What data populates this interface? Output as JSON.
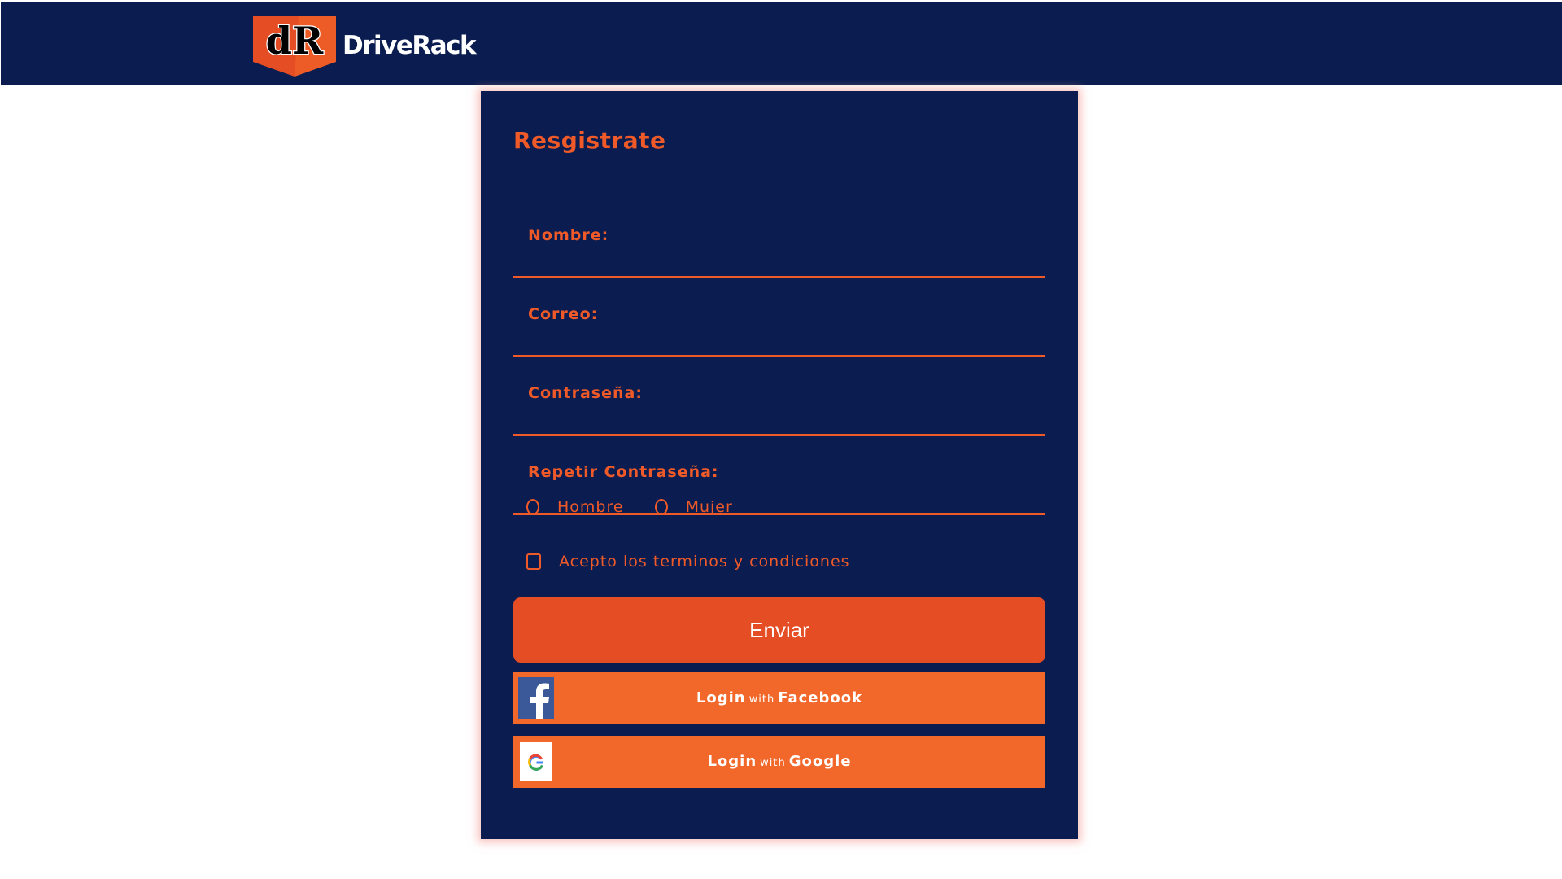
{
  "header": {
    "brand_name": "DriveRack",
    "logo_mark": "dR",
    "background_color": "#0b1d50"
  },
  "form": {
    "title": "Resgistrate",
    "fields": [
      {
        "label": "Nombre:",
        "value": ""
      },
      {
        "label": "Correo:",
        "value": ""
      },
      {
        "label": "Contraseña:",
        "value": ""
      },
      {
        "label": "Repetir Contraseña:",
        "value": ""
      }
    ],
    "gender_options": [
      "Hombre",
      "Mujer"
    ],
    "terms_label": "Acepto los terminos y condiciones",
    "submit_label": "Enviar",
    "facebook": {
      "login": "Login",
      "with": "with",
      "provider": "Facebook",
      "icon": "facebook-icon"
    },
    "google": {
      "login": "Login",
      "with": "with",
      "provider": "Google",
      "icon": "google-icon"
    }
  },
  "colors": {
    "accent": "#f05a28",
    "submit": "#e54d24",
    "social_button": "#f2672a",
    "card": "#0b1d50",
    "facebook_blue": "#3b5998"
  }
}
